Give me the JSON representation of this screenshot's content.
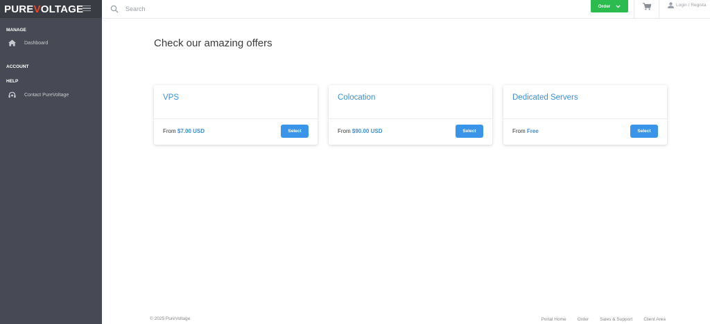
{
  "brand": {
    "logo_part1": "PURE",
    "logo_v": "V",
    "logo_part2": "OLTAGE",
    "accent_color": "#e8452c"
  },
  "sidebar": {
    "sections": [
      {
        "label": "MANAGE",
        "items": [
          {
            "label": "Dashboard",
            "icon": "home-icon"
          }
        ]
      },
      {
        "label": "ACCOUNT",
        "items": []
      },
      {
        "label": "HELP",
        "items": [
          {
            "label": "Contact PureVoltage",
            "icon": "headset-icon"
          }
        ]
      }
    ]
  },
  "topbar": {
    "search_placeholder": "Search",
    "order_label": "Order",
    "login_label": "Login / Regista"
  },
  "main": {
    "title": "Check our amazing offers",
    "offers": [
      {
        "title": "VPS",
        "price_prefix": "From ",
        "price": "$7.00 USD",
        "button": "Select"
      },
      {
        "title": "Colocation",
        "price_prefix": "From ",
        "price": "$90.00 USD",
        "button": "Select"
      },
      {
        "title": "Dedicated Servers",
        "price_prefix": "From ",
        "price": "Free",
        "button": "Select"
      }
    ]
  },
  "footer": {
    "copyright": "© 2025 PureVoltage",
    "links": [
      "Portal Home",
      "Order",
      "Sales & Support",
      "Client Area"
    ]
  },
  "colors": {
    "sidebar_bg": "#474a54",
    "order_green": "#2bbb4f",
    "link_blue": "#3a8fd9",
    "button_blue": "#3a95ea"
  }
}
